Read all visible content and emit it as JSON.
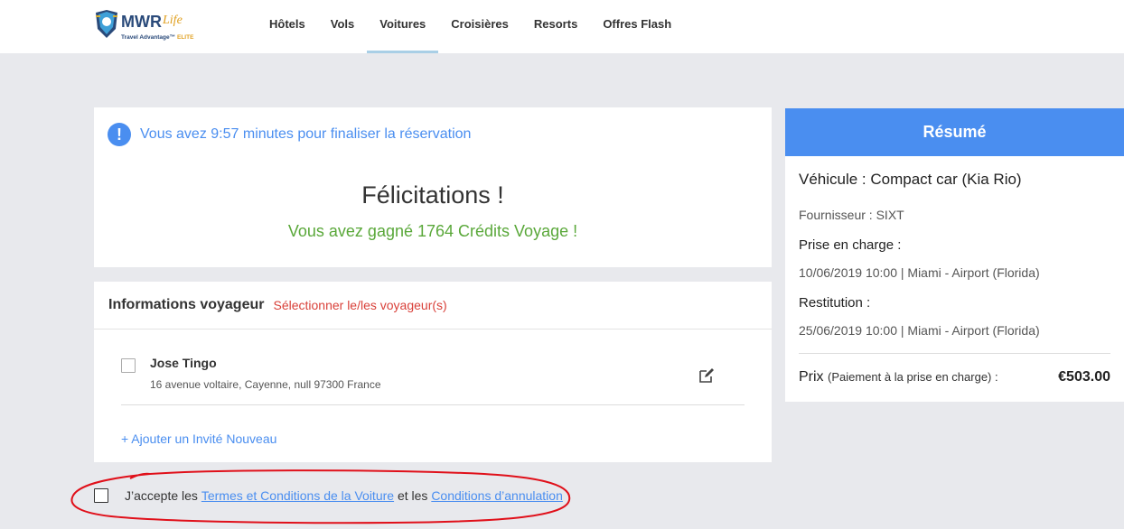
{
  "header": {
    "logo_text": "MWR Life",
    "logo_tagline": "Travel Advantage ELITE",
    "nav": [
      {
        "label": "Hôtels",
        "active": false
      },
      {
        "label": "Vols",
        "active": false
      },
      {
        "label": "Voitures",
        "active": true
      },
      {
        "label": "Croisières",
        "active": false
      },
      {
        "label": "Resorts",
        "active": false
      },
      {
        "label": "Offres Flash",
        "active": false
      }
    ]
  },
  "timer": {
    "icon": "exclamation-icon",
    "text": "Vous avez 9:57 minutes pour finaliser la réservation"
  },
  "confirmation": {
    "title": "Félicitations !",
    "credits": "Vous avez gagné 1764 Crédits Voyage !"
  },
  "traveler_info": {
    "title": "Informations voyageur",
    "select_link": "Sélectionner le/les voyageur(s)",
    "travelers": [
      {
        "name": "Jose Tingo",
        "address": "16 avenue voltaire, Cayenne, null 97300 France"
      }
    ],
    "add_guest": "+ Ajouter un Invité Nouveau"
  },
  "terms": {
    "prefix": "J’accepte les",
    "link1": "Termes et Conditions de la Voiture",
    "middle": "et les",
    "link2": "Conditions d’annulation"
  },
  "summary": {
    "header": "Résumé",
    "vehicle": "Véhicule : Compact car (Kia Rio)",
    "supplier": "Fournisseur : SIXT",
    "pickup_label": "Prise en charge :",
    "pickup_value": "10/06/2019 10:00 | Miami - Airport (Florida)",
    "return_label": "Restitution :",
    "return_value": "25/06/2019 10:00 | Miami - Airport (Florida)",
    "price_label": "Prix",
    "price_note": "(Paiement à la prise en charge) :",
    "price_value": "€503.00"
  },
  "colors": {
    "accent": "#4a8ef0",
    "success": "#5aa83a",
    "error": "#d9413a",
    "annotation": "#e0101a"
  }
}
